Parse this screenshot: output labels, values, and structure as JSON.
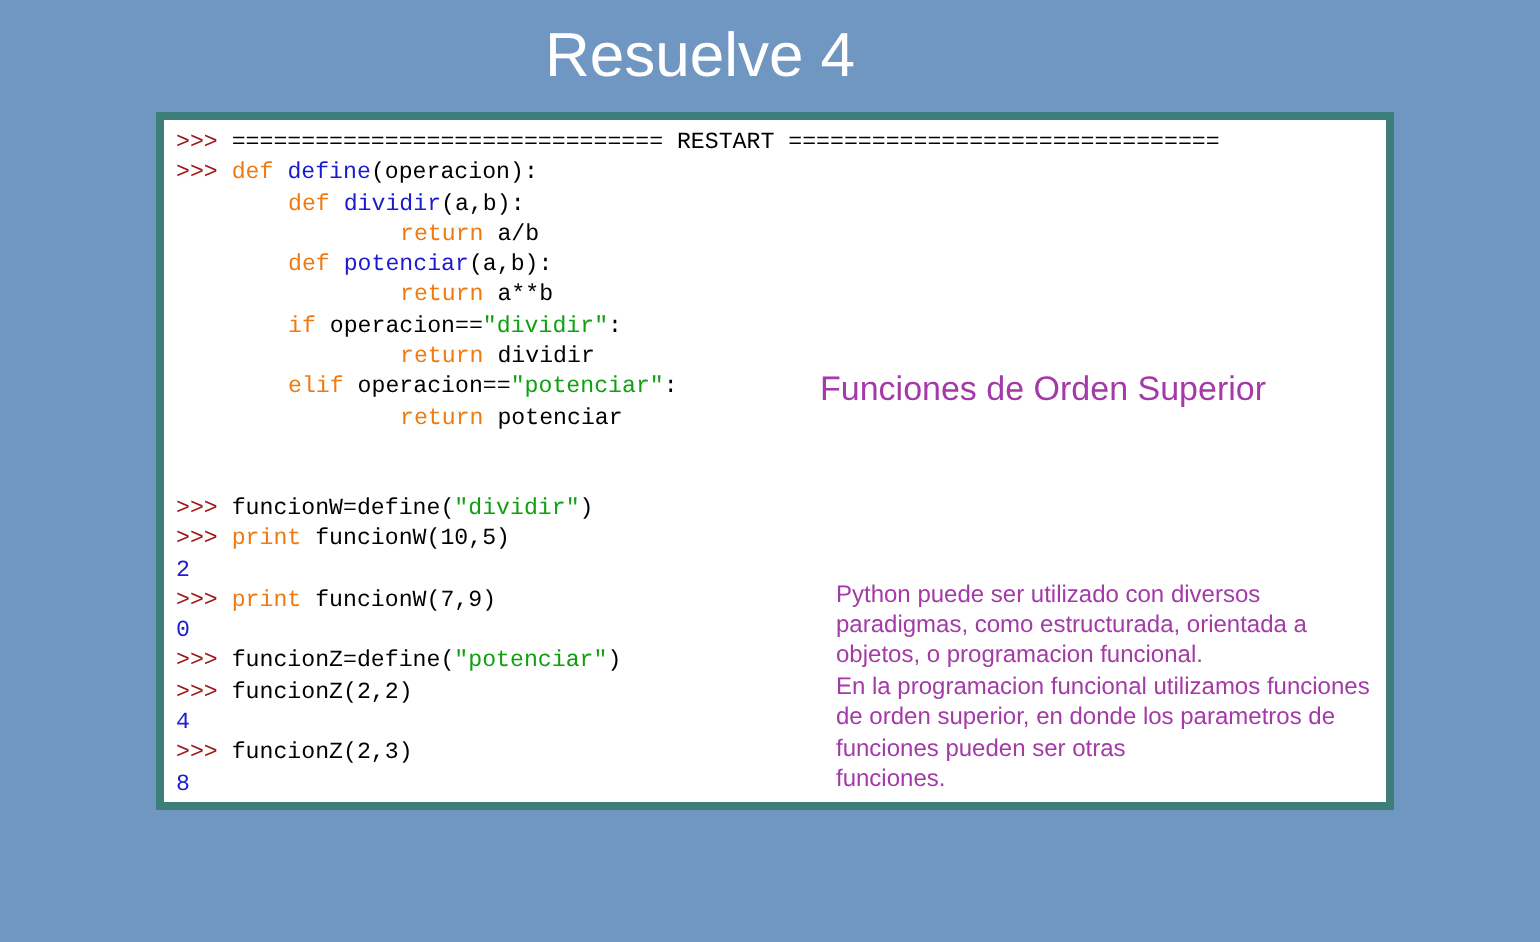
{
  "title": "Resuelve 4",
  "code": {
    "blocks": [
      {
        "lines": [
          {
            "kind": "top",
            "tokens": [
              {
                "kind": "prompt",
                "text": ">>> "
              },
              {
                "kind": "plain",
                "text": "=============================== RESTART ==============================="
              }
            ]
          },
          {
            "kind": "top",
            "tokens": [
              {
                "kind": "prompt",
                "text": ">>> "
              },
              {
                "kind": "keyword",
                "text": "def "
              },
              {
                "kind": "name",
                "text": "define"
              },
              {
                "kind": "plain",
                "text": "(operacion):"
              }
            ]
          },
          {
            "kind": "body",
            "tokens": [
              {
                "kind": "keyword",
                "text": "def "
              },
              {
                "kind": "name",
                "text": "dividir"
              },
              {
                "kind": "plain",
                "text": "(a,b):"
              }
            ]
          },
          {
            "kind": "inner",
            "tokens": [
              {
                "kind": "keyword",
                "text": "return "
              },
              {
                "kind": "plain",
                "text": "a/b"
              }
            ]
          },
          {
            "kind": "body",
            "tokens": [
              {
                "kind": "keyword",
                "text": "def "
              },
              {
                "kind": "name",
                "text": "potenciar"
              },
              {
                "kind": "plain",
                "text": "(a,b):"
              }
            ]
          },
          {
            "kind": "inner",
            "tokens": [
              {
                "kind": "keyword",
                "text": "return "
              },
              {
                "kind": "plain",
                "text": "a**b"
              }
            ]
          },
          {
            "kind": "body",
            "tokens": [
              {
                "kind": "keyword",
                "text": "if "
              },
              {
                "kind": "plain",
                "text": "operacion=="
              },
              {
                "kind": "string",
                "text": "\"dividir\""
              },
              {
                "kind": "plain",
                "text": ":"
              }
            ]
          },
          {
            "kind": "inner",
            "tokens": [
              {
                "kind": "keyword",
                "text": "return "
              },
              {
                "kind": "plain",
                "text": "dividir"
              }
            ]
          },
          {
            "kind": "body",
            "tokens": [
              {
                "kind": "keyword",
                "text": "elif "
              },
              {
                "kind": "plain",
                "text": "operacion=="
              },
              {
                "kind": "string",
                "text": "\"potenciar\""
              },
              {
                "kind": "plain",
                "text": ":"
              }
            ]
          },
          {
            "kind": "inner",
            "tokens": [
              {
                "kind": "keyword",
                "text": "return "
              },
              {
                "kind": "plain",
                "text": "potenciar"
              }
            ]
          }
        ]
      },
      {
        "lines": [
          {
            "kind": "top",
            "tokens": [
              {
                "kind": "prompt",
                "text": ">>> "
              },
              {
                "kind": "plain",
                "text": "funcionW=define("
              },
              {
                "kind": "string",
                "text": "\"dividir\""
              },
              {
                "kind": "plain",
                "text": ")"
              }
            ]
          },
          {
            "kind": "top",
            "tokens": [
              {
                "kind": "prompt",
                "text": ">>> "
              },
              {
                "kind": "keyword",
                "text": "print "
              },
              {
                "kind": "plain",
                "text": "funcionW(10,5)"
              }
            ]
          },
          {
            "kind": "top",
            "tokens": [
              {
                "kind": "output",
                "text": "2"
              }
            ]
          },
          {
            "kind": "top",
            "tokens": [
              {
                "kind": "prompt",
                "text": ">>> "
              },
              {
                "kind": "keyword",
                "text": "print "
              },
              {
                "kind": "plain",
                "text": "funcionW(7,9)"
              }
            ]
          },
          {
            "kind": "top",
            "tokens": [
              {
                "kind": "output",
                "text": "0"
              }
            ]
          },
          {
            "kind": "top",
            "tokens": [
              {
                "kind": "prompt",
                "text": ">>> "
              },
              {
                "kind": "plain",
                "text": "funcionZ=define("
              },
              {
                "kind": "string",
                "text": "\"potenciar\""
              },
              {
                "kind": "plain",
                "text": ")"
              }
            ]
          },
          {
            "kind": "top",
            "tokens": [
              {
                "kind": "prompt",
                "text": ">>> "
              },
              {
                "kind": "plain",
                "text": "funcionZ(2,2)"
              }
            ]
          },
          {
            "kind": "top",
            "tokens": [
              {
                "kind": "output",
                "text": "4"
              }
            ]
          },
          {
            "kind": "top",
            "tokens": [
              {
                "kind": "prompt",
                "text": ">>> "
              },
              {
                "kind": "plain",
                "text": "funcionZ(2,3)"
              }
            ]
          },
          {
            "kind": "top",
            "tokens": [
              {
                "kind": "output",
                "text": "8"
              }
            ]
          }
        ]
      }
    ]
  },
  "heading": "Funciones de Orden Superior",
  "note": {
    "lines": [
      "Python puede ser utilizado con diversos",
      "paradigmas, como estructurada, orientada a",
      "objetos, o programacion funcional.",
      "En la programacion funcional utilizamos funciones",
      "de orden superior, en donde los parametros de",
      "funciones pueden ser otras",
      "funciones."
    ]
  }
}
